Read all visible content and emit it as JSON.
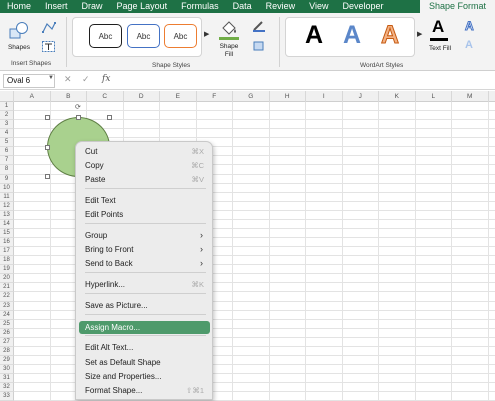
{
  "tabs": [
    "Home",
    "Insert",
    "Draw",
    "Page Layout",
    "Formulas",
    "Data",
    "Review",
    "View",
    "Developer",
    "Shape Format"
  ],
  "ribbon": {
    "shapes_label": "Shapes",
    "insert_shapes_label": "Insert Shapes",
    "style_boxes": [
      "Abc",
      "Abc",
      "Abc"
    ],
    "style_colors": [
      "#1f1f1f",
      "#4472c4",
      "#ed7d31"
    ],
    "shape_fill_label": "Shape Fill",
    "shape_styles_label": "Shape Styles",
    "wordart_letters": [
      "A",
      "A",
      "A"
    ],
    "text_fill_label": "Text Fill",
    "wordart_styles_label": "WordArt Styles"
  },
  "formula_bar": {
    "name_box": "Oval 6",
    "fx": "fx"
  },
  "columns": [
    "A",
    "B",
    "C",
    "D",
    "E",
    "F",
    "G",
    "H",
    "I",
    "J",
    "K",
    "L",
    "M"
  ],
  "rows": [
    "1",
    "2",
    "3",
    "4",
    "5",
    "6",
    "7",
    "8",
    "9",
    "10",
    "11",
    "12",
    "13",
    "14",
    "15",
    "16",
    "17",
    "18",
    "19",
    "20",
    "21",
    "22",
    "23",
    "24",
    "25",
    "26",
    "27",
    "28",
    "29",
    "30",
    "31",
    "32",
    "33"
  ],
  "menu": {
    "items": [
      {
        "label": "Cut",
        "shortcut": "⌘X"
      },
      {
        "label": "Copy",
        "shortcut": "⌘C"
      },
      {
        "label": "Paste",
        "shortcut": "⌘V"
      },
      {
        "label": "Edit Text",
        "shortcut": ""
      },
      {
        "label": "Edit Points",
        "shortcut": ""
      },
      {
        "label": "Group",
        "shortcut": "",
        "submenu": true
      },
      {
        "label": "Bring to Front",
        "shortcut": "",
        "submenu": true
      },
      {
        "label": "Send to Back",
        "shortcut": "",
        "submenu": true
      },
      {
        "label": "Hyperlink...",
        "shortcut": "⌘K"
      },
      {
        "label": "Save as Picture...",
        "shortcut": ""
      },
      {
        "label": "Assign Macro...",
        "shortcut": "",
        "selected": true
      },
      {
        "label": "Edit Alt Text...",
        "shortcut": ""
      },
      {
        "label": "Set as Default Shape",
        "shortcut": ""
      },
      {
        "label": "Size and Properties...",
        "shortcut": ""
      },
      {
        "label": "Format Shape...",
        "shortcut": "⇧⌘1"
      }
    ]
  },
  "colors": {
    "accent": "#1e7145",
    "shape_fill": "#a9d18e",
    "menu_highlight": "#4e9a6b"
  }
}
